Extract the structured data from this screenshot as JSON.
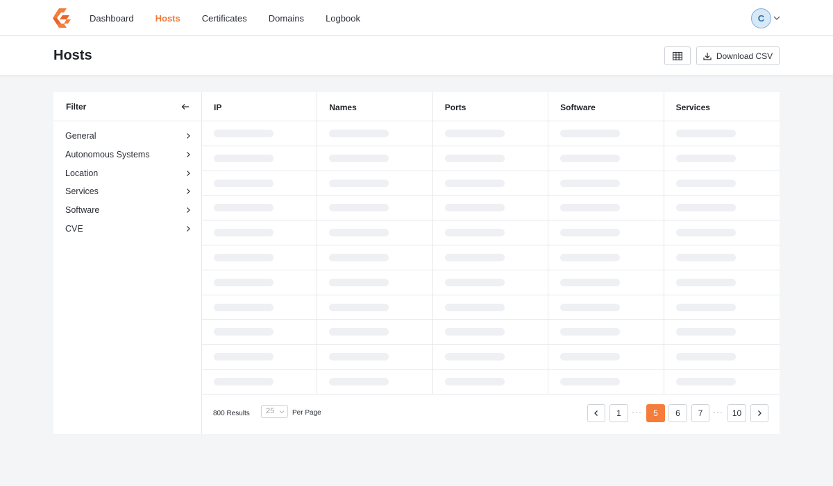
{
  "nav": {
    "items": [
      {
        "label": "Dashboard",
        "active": false
      },
      {
        "label": "Hosts",
        "active": true
      },
      {
        "label": "Certificates",
        "active": false
      },
      {
        "label": "Domains",
        "active": false
      },
      {
        "label": "Logbook",
        "active": false
      }
    ],
    "avatar_initial": "C",
    "accent_color": "#f07a36"
  },
  "page": {
    "title": "Hosts",
    "download_label": "Download CSV"
  },
  "filter": {
    "title": "Filter",
    "items": [
      "General",
      "Autonomous Systems",
      "Location",
      "Services",
      "Software",
      "CVE"
    ]
  },
  "table": {
    "columns": [
      "IP",
      "Names",
      "Ports",
      "Software",
      "Services"
    ],
    "row_count": 11,
    "state": "loading"
  },
  "footer": {
    "results_text": "800 Results",
    "per_page_value": "25",
    "per_page_label": "Per Page",
    "pages": [
      {
        "label": "1",
        "current": false
      },
      {
        "label": "5",
        "current": true
      },
      {
        "label": "6",
        "current": false
      },
      {
        "label": "7",
        "current": false
      },
      {
        "label": "10",
        "current": false
      }
    ],
    "ellipsis": "···"
  }
}
